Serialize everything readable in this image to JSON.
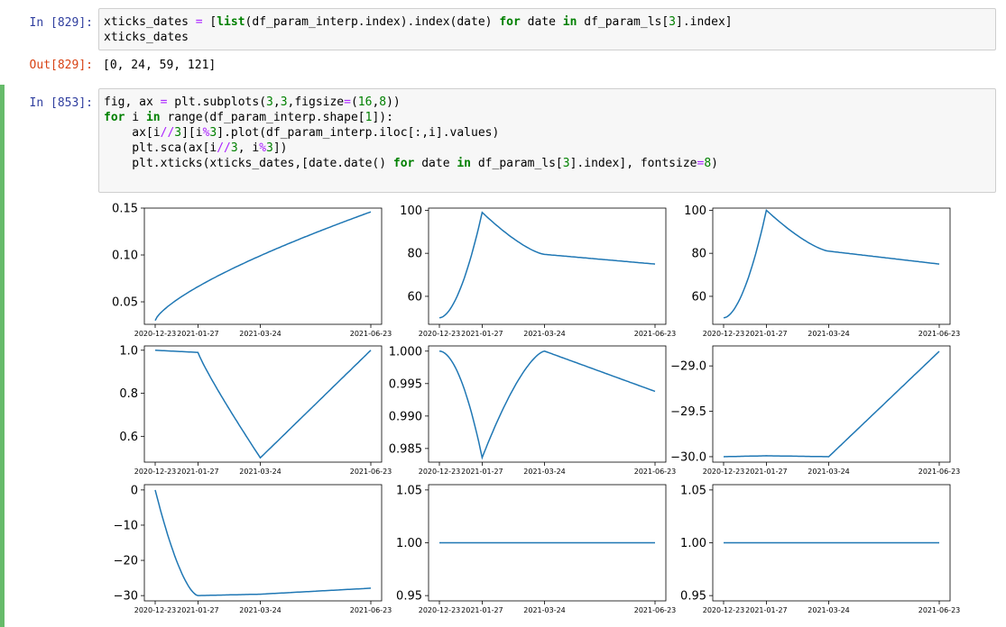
{
  "cells": [
    {
      "in_prompt": "In [829]:",
      "code_lines": [
        "xticks_dates = [list(df_param_interp.index).index(date) for date in df_param_ls[3].index]",
        "xticks_dates"
      ],
      "out_prompt": "Out[829]:",
      "output": "[0, 24, 59, 121]"
    },
    {
      "in_prompt": "In [853]:",
      "code_lines": [
        "fig, ax = plt.subplots(3,3,figsize=(16,8))",
        "for i in range(df_param_interp.shape[1]):",
        "    ax[i//3][i%3].plot(df_param_interp.iloc[:,i].values)",
        "    plt.sca(ax[i//3, i%3])",
        "    plt.xticks(xticks_dates,[date.date() for date in df_param_ls[3].index], fontsize=8)"
      ]
    }
  ],
  "colors": {
    "line": "#1f77b4",
    "selected_cell_bar": "#66bb6a",
    "in_prompt": "#303f9f",
    "out_prompt": "#d84315"
  },
  "chart_data": [
    {
      "type": "line",
      "x": [
        0,
        24,
        59,
        121
      ],
      "xticklabels": [
        "2020-12-23",
        "2021-01-27",
        "2021-03-24",
        "2021-06-23"
      ],
      "y": [
        0.03,
        0.066,
        0.105,
        0.146
      ],
      "yticks": [
        "0.15",
        "0.10",
        "0.05"
      ],
      "ylim": [
        0.026,
        0.15
      ]
    },
    {
      "type": "line",
      "x": [
        0,
        24,
        59,
        121
      ],
      "xticklabels": [
        "2020-12-23",
        "2021-01-27",
        "2021-03-24",
        "2021-06-23"
      ],
      "y": [
        50,
        99,
        79.5,
        75
      ],
      "yticks": [
        "100",
        "80",
        "60"
      ],
      "ylim": [
        47,
        101
      ]
    },
    {
      "type": "line",
      "x": [
        0,
        24,
        59,
        121
      ],
      "xticklabels": [
        "2020-12-23",
        "2021-01-27",
        "2021-03-24",
        "2021-06-23"
      ],
      "y": [
        50,
        100,
        81,
        75
      ],
      "yticks": [
        "100",
        "80",
        "60"
      ],
      "ylim": [
        47,
        101
      ]
    },
    {
      "type": "line",
      "x": [
        0,
        24,
        59,
        121
      ],
      "xticklabels": [
        "2020-12-23",
        "2021-01-27",
        "2021-03-24",
        "2021-06-23"
      ],
      "y": [
        1.0,
        0.99,
        0.5,
        1.0
      ],
      "yticks": [
        "1.0",
        "0.8",
        "0.6"
      ],
      "ylim": [
        0.48,
        1.02
      ]
    },
    {
      "type": "line",
      "x": [
        0,
        24,
        59,
        121
      ],
      "xticklabels": [
        "2020-12-23",
        "2021-01-27",
        "2021-03-24",
        "2021-06-23"
      ],
      "y": [
        1.0,
        0.9836,
        1.0,
        0.9938
      ],
      "yticks": [
        "1.000",
        "0.995",
        "0.990",
        "0.985"
      ],
      "ylim": [
        0.9829,
        1.0008
      ]
    },
    {
      "type": "line",
      "x": [
        0,
        24,
        59,
        121
      ],
      "xticklabels": [
        "2020-12-23",
        "2021-01-27",
        "2021-03-24",
        "2021-06-23"
      ],
      "y": [
        -30.0,
        -29.99,
        -30.0,
        -28.84
      ],
      "yticks": [
        "-29.0",
        "-29.5",
        "-30.0"
      ],
      "ylim": [
        -30.06,
        -28.78
      ]
    },
    {
      "type": "line",
      "x": [
        0,
        24,
        59,
        121
      ],
      "xticklabels": [
        "2020-12-23",
        "2021-01-27",
        "2021-03-24",
        "2021-06-23"
      ],
      "y": [
        0,
        -30,
        -29.6,
        -27.9
      ],
      "yticks": [
        "0",
        "-10",
        "-20",
        "-30"
      ],
      "ylim": [
        -31.5,
        1.5
      ]
    },
    {
      "type": "line",
      "x": [
        0,
        24,
        59,
        121
      ],
      "xticklabels": [
        "2020-12-23",
        "2021-01-27",
        "2021-03-24",
        "2021-06-23"
      ],
      "y": [
        1.0,
        1.0,
        1.0,
        1.0
      ],
      "yticks": [
        "1.05",
        "1.00",
        "0.95"
      ],
      "ylim": [
        0.945,
        1.055
      ]
    },
    {
      "type": "line",
      "x": [
        0,
        24,
        59,
        121
      ],
      "xticklabels": [
        "2020-12-23",
        "2021-01-27",
        "2021-03-24",
        "2021-06-23"
      ],
      "y": [
        1.0,
        1.0,
        1.0,
        1.0
      ],
      "yticks": [
        "1.05",
        "1.00",
        "0.95"
      ],
      "ylim": [
        0.945,
        1.055
      ]
    }
  ]
}
